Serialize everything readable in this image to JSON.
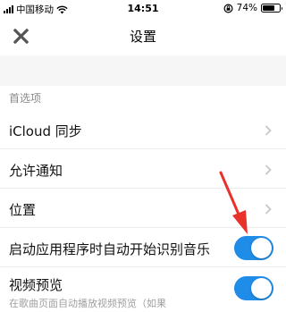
{
  "status_bar": {
    "carrier": "中国移动",
    "time": "14:51",
    "battery_text": "74%",
    "battery_level": 0.74,
    "icons": [
      "signal-icon",
      "wifi-icon",
      "orientation-lock-icon",
      "battery-icon"
    ]
  },
  "nav": {
    "title": "设置",
    "close_icon": "close-icon"
  },
  "section": {
    "header": "首选项"
  },
  "rows": [
    {
      "label": "iCloud 同步",
      "control": "chevron"
    },
    {
      "label": "允许通知",
      "control": "chevron"
    },
    {
      "label": "位置",
      "control": "chevron"
    },
    {
      "label": "启动应用程序时自动开始识别音乐",
      "control": "toggle",
      "on": true
    },
    {
      "label": "视频预览",
      "control": "toggle",
      "on": true,
      "sublabel": "在歌曲页面自动播放视频预览（如果"
    }
  ],
  "colors": {
    "toggle_on": "#1f8ce8",
    "annotation_arrow": "#e8322b",
    "section_background": "#f6f6f6"
  }
}
